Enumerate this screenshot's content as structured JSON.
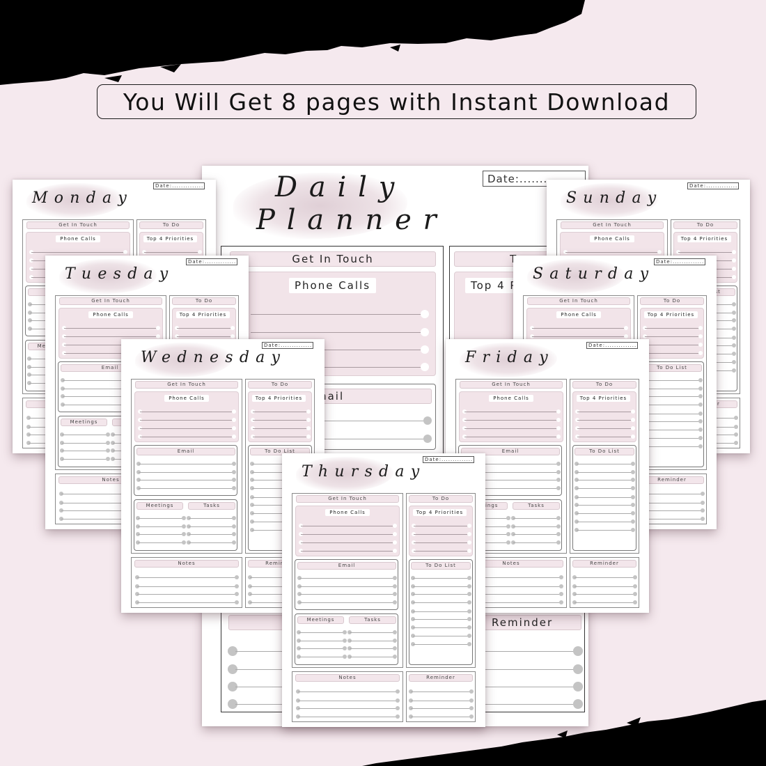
{
  "banner": {
    "text": "You Will Get 8 pages with Instant Download"
  },
  "colors": {
    "background": "#f5e9ee",
    "brush": "#000000",
    "pink_section": "#f2e4e9",
    "pill": "#f3e6eb",
    "dot": "#c4c4c4"
  },
  "labels": {
    "date": "Date:................",
    "get_in_touch": "Get In Touch",
    "phone_calls": "Phone Calls",
    "to_do": "To Do",
    "top_priorities": "Top 4 Priorities",
    "email": "Email",
    "to_do_list": "To Do List",
    "meetings": "Meetings",
    "tasks": "Tasks",
    "notes": "Notes",
    "reminder": "Reminder"
  },
  "cover": {
    "title_line1": "Daily",
    "title_line2": "Planner",
    "date": "Date:........",
    "get_in_touch": "Get In Touch",
    "phone_calls": "Phone Calls",
    "to_do_partial": "To",
    "top_priorities_partial": "Top 4 P",
    "email_partial": "mail",
    "reminder": "Reminder"
  },
  "pages": [
    {
      "day": "Monday"
    },
    {
      "day": "Sunday"
    },
    {
      "day": "Tuesday"
    },
    {
      "day": "Saturday"
    },
    {
      "day": "Wednesday"
    },
    {
      "day": "Friday"
    },
    {
      "day": "Thursday"
    }
  ]
}
